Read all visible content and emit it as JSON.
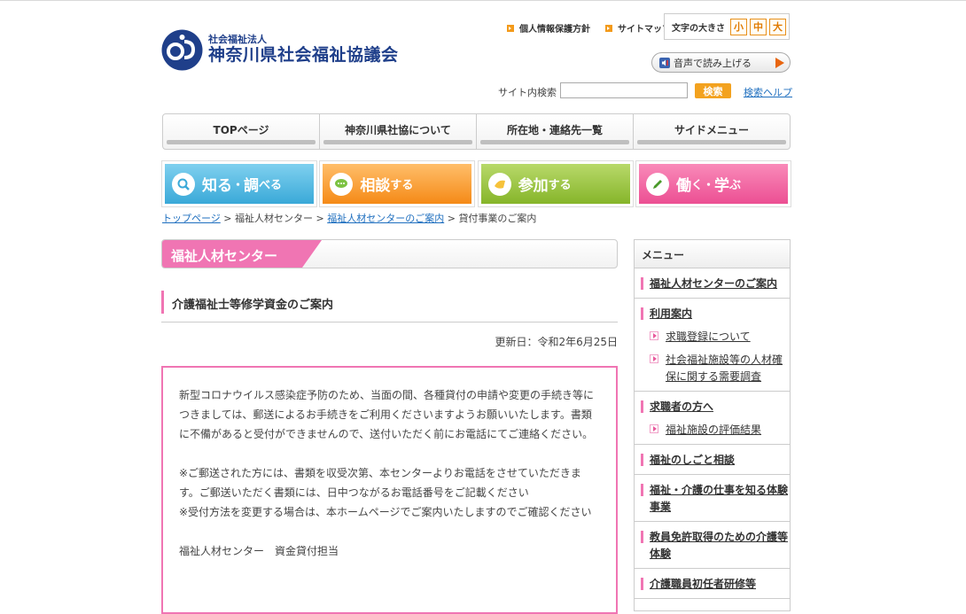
{
  "header": {
    "org_type": "社会福祉法人",
    "org_name": "神奈川県社会福祉協議会",
    "util_links": [
      "個人情報保護方針",
      "サイトマップ"
    ],
    "font_size_label": "文字の大きさ",
    "font_sizes": [
      "小",
      "中",
      "大"
    ],
    "voice_label": "音声で読み上げる",
    "search_label": "サイト内検索",
    "search_value": "",
    "search_button": "検索",
    "search_help": "検索ヘルプ"
  },
  "global_nav": [
    "TOPページ",
    "神奈川県社協について",
    "所在地・連絡先一覧",
    "サイドメニュー"
  ],
  "categories": [
    {
      "big1": "知る",
      "small1": "・",
      "big2": "調",
      "small2": "べる",
      "icon": "magnifier-icon"
    },
    {
      "big1": "相談",
      "small1": "する",
      "icon": "speech-bubble-icon"
    },
    {
      "big1": "参加",
      "small1": "する",
      "icon": "hand-icon"
    },
    {
      "big1": "働",
      "small1": "く・",
      "big2": "学",
      "small2": "ぶ",
      "icon": "pencil-icon"
    }
  ],
  "breadcrumb": {
    "home": "トップページ",
    "sep": " > ",
    "level1": "福祉人材センター",
    "level2": "福祉人材センターのご案内",
    "current": "貸付事業のご案内"
  },
  "section_title": "福祉人材センター",
  "page_title": "介護福祉士等修学資金のご案内",
  "updated": "更新日：令和2年6月25日",
  "notice": {
    "p1": "新型コロナウイルス感染症予防のため、当面の間、各種貸付の申請や変更の手続き等につきましては、郵送によるお手続きをご利用くださいますようお願いいたします。書類に不備があると受付ができませんので、送付いただく前にお電話にてご連絡ください。",
    "p2": "※ご郵送された方には、書類を収受次第、本センターよりお電話をさせていただきます。ご郵送いただく書類には、日中つながるお電話番号をご記載ください",
    "p3": "※受付方法を変更する場合は、本ホームページでご案内いたしますのでご確認ください",
    "p4": "福祉人材センター　資金貸付担当"
  },
  "side_menu": {
    "title": "メニュー",
    "sections": [
      {
        "label": "福祉人材センターのご案内",
        "items": []
      },
      {
        "label": "利用案内",
        "items": [
          "求職登録について",
          "社会福祉施設等の人材確保に関する需要調査"
        ]
      },
      {
        "label": "求職者の方へ",
        "items": [
          "福祉施設の評価結果"
        ]
      },
      {
        "label": "福祉のしごと相談",
        "items": []
      },
      {
        "label": "福祉・介護の仕事を知る体験事業",
        "items": []
      },
      {
        "label": "教員免許取得のための介護等体験",
        "items": []
      },
      {
        "label": "介護職員初任者研修等",
        "items": []
      }
    ]
  },
  "colors": {
    "accent_pink": "#f075b3",
    "brand_blue": "#1f3f8a",
    "orange": "#f39a1a",
    "link_blue": "#1f6fbf"
  }
}
